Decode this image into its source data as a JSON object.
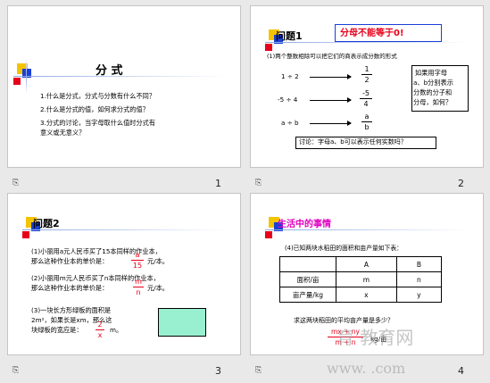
{
  "slides": [
    {
      "number": "1",
      "title": "分 式",
      "questions": [
        "1.什么是分式，分式与分数有什么不同？",
        "2.什么是分式的值，如何求分式的值？",
        "3.分式的讨论，当字母取什么值时分式有",
        "意义或无意义？"
      ]
    },
    {
      "number": "2",
      "heading": "问题1",
      "banner": "分母不能等于0!",
      "intro": "(1)两个整数相除可以把它们的商表示成分数的形式",
      "rows": [
        {
          "expr": "1 ÷ 2",
          "num": "1",
          "den": "2"
        },
        {
          "expr": "-5 ÷ 4",
          "num": "-5",
          "den": "4"
        },
        {
          "expr": "a ÷ b",
          "num": "a",
          "den": "b"
        }
      ],
      "note": [
        "如果用字母",
        "a、b分别表示",
        "分数的分子和",
        "分母，如何？"
      ],
      "question": "讨论：字母a、b可以表示任何实数吗？"
    },
    {
      "number": "3",
      "heading": "问题2",
      "items": [
        {
          "lines": [
            "(1)小丽用a元人民币买了15本同样的作业本，",
            "那么这种作业本的单价是："
          ],
          "num": "a",
          "den": "15",
          "unit": "元/本。"
        },
        {
          "lines": [
            "(2)小丽用m元人民币买了n本同样的作业本，",
            "那么这种作业本的单价是："
          ],
          "num": "m",
          "den": "n",
          "unit": "元/本。"
        },
        {
          "lines": [
            "(3)一块长方形绿板的面积是",
            "2m²，如果长是xm，那么这",
            "块绿板的宽应是："
          ],
          "num": "2",
          "den": "x",
          "unit": "m。"
        }
      ],
      "rect_color": "#99f0d0"
    },
    {
      "number": "4",
      "heading": "生活中的事情",
      "intro": "(4)已知两块水稻田的面积和亩产量如下表：",
      "table": {
        "headers": [
          "",
          "A",
          "B"
        ],
        "rows": [
          [
            "面积/亩",
            "m",
            "n"
          ],
          [
            "亩产量/kg",
            "x",
            "y"
          ]
        ]
      },
      "question": "求这两块稻田的平均亩产量是多少？",
      "answer_num": "mx + ny",
      "answer_den": "m + n",
      "answer_unit": "kg/亩",
      "watermark": {
        "cn": "育  教育网",
        "url": "www.     .com"
      }
    }
  ],
  "slide_icon": "⎘",
  "colors": {
    "red": "#e8001a",
    "blue": "#1a3fd6",
    "magenta": "#e000c0",
    "yellow": "#f5c400"
  }
}
